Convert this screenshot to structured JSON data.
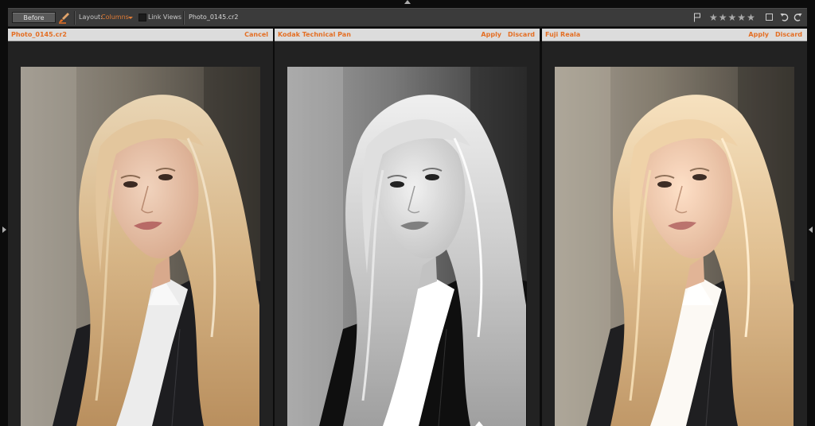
{
  "toolbar": {
    "before_label": "Before",
    "layout_label": "Layout:",
    "layout_value": "Columns",
    "link_views_label": "Link Views",
    "link_views_checked": false,
    "file_name": "Photo_0145.cr2",
    "rating_stars": [
      "★",
      "★",
      "★",
      "★",
      "★"
    ],
    "colors": {
      "accent": "#e46f24",
      "toolbar_bg": "#3b3b3b"
    }
  },
  "panels": [
    {
      "title": "Photo_0145.cr2",
      "actions": [
        "Cancel"
      ],
      "style": "original"
    },
    {
      "title": "Kodak Technical Pan",
      "actions": [
        "Apply",
        "Discard"
      ],
      "style": "black-and-white"
    },
    {
      "title": "Fuji Reala",
      "actions": [
        "Apply",
        "Discard"
      ],
      "style": "color-film"
    }
  ],
  "icons": [
    "brush-icon",
    "flag-icon",
    "star-icon",
    "square-icon",
    "undo-icon",
    "redo-icon"
  ]
}
